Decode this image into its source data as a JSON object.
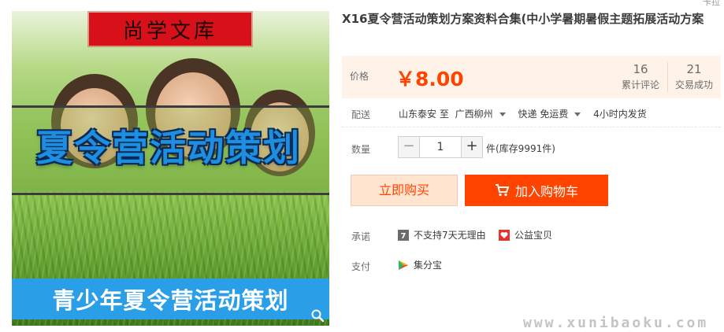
{
  "image": {
    "brand": "尚学文库",
    "headline": "夏令营活动策划",
    "bottom_banner": "青少年夏令营活动策划",
    "zoom_icon": "magnifier-icon"
  },
  "product": {
    "title": "X16夏令营活动策划方案资料合集(中小学暑期暑假主题拓展活动方案"
  },
  "price": {
    "label": "价格",
    "value": "￥8.00",
    "reviews_count": "16",
    "reviews_label": "累计评论",
    "sales_count": "21",
    "sales_label": "交易成功"
  },
  "delivery": {
    "label": "配送",
    "from": "山东泰安 至",
    "to": "广西柳州",
    "shipping": "快递 免运费",
    "dispatch": "4小时内发货"
  },
  "quantity": {
    "label": "数量",
    "minus": "−",
    "value": "1",
    "plus": "+",
    "stock": "件(库存9991件)"
  },
  "actions": {
    "buy_now": "立即购买",
    "add_to_cart": "加入购物车"
  },
  "promise": {
    "label": "承诺",
    "no_return": "不支持7天无理由",
    "charity": "公益宝贝"
  },
  "payment": {
    "label": "支付",
    "method": "集分宝"
  },
  "watermark": "www.xunibaoku.com",
  "colors": {
    "accent": "#ff4400",
    "price_bg": "#fff2e8",
    "banner_blue": "#2a9ee6",
    "brand_red": "#d8101a"
  }
}
